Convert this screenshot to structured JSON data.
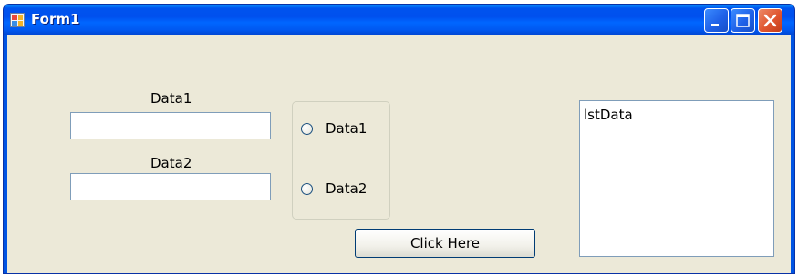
{
  "window": {
    "title": "Form1"
  },
  "form": {
    "textbox1_label": "Data1",
    "textbox1_value": "",
    "textbox2_label": "Data2",
    "textbox2_value": "",
    "radio_options": [
      "Data1",
      "Data2"
    ],
    "button_label": "Click Here",
    "listbox_items": [
      "lstData"
    ]
  }
}
